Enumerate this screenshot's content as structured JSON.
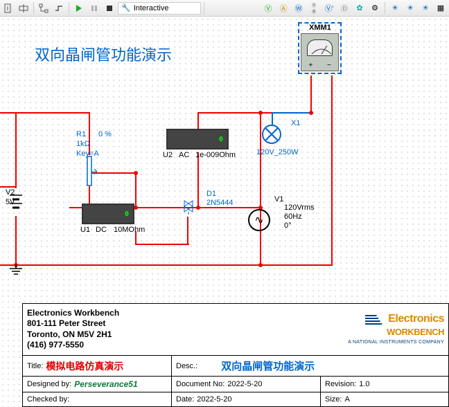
{
  "toolbar": {
    "mode_label": "Interactive"
  },
  "schematic": {
    "title": "双向晶闸管功能演示",
    "instruments": {
      "xmm1": {
        "ref": "XMM1"
      }
    },
    "components": {
      "r1": {
        "ref": "R1",
        "value": "1kΩ",
        "key": "Key=A",
        "percent": "0 %"
      },
      "v2": {
        "ref": "V2",
        "value": "5V"
      },
      "u1": {
        "ref": "U1",
        "mode": "DC",
        "imp": "10MOhm",
        "reading": "0"
      },
      "u2": {
        "ref": "U2",
        "mode": "AC",
        "imp": "1e-009Ohm",
        "reading": "0"
      },
      "d1": {
        "ref": "D1",
        "part": "2N5444"
      },
      "v1": {
        "ref": "V1",
        "amp": "120Vrms",
        "freq": "60Hz",
        "phase": "0°"
      },
      "x1": {
        "ref": "X1",
        "spec": "120V_250W"
      }
    }
  },
  "titleblock": {
    "company": "Electronics Workbench",
    "addr1": "801-111 Peter Street",
    "addr2": "Toronto, ON M5V 2H1",
    "phone": "(416) 977-5550",
    "logo_main": "Electronics",
    "logo_sub": "WORKBENCH",
    "logo_tag": "A NATIONAL INSTRUMENTS COMPANY",
    "title_lbl": "Title:",
    "title_val": "模拟电路仿真演示",
    "desc_lbl": "Desc.:",
    "desc_val": "双向晶闸管功能演示",
    "designed_lbl": "Designed by:",
    "designed_val": "Perseverance51",
    "docno_lbl": "Document No:",
    "docno_val": "2022-5-20",
    "rev_lbl": "Revision:",
    "rev_val": "1.0",
    "checked_lbl": "Checked by:",
    "checked_val": "",
    "date_lbl": "Date:",
    "date_val": "2022-5-20",
    "size_lbl": "Size:",
    "size_val": "A"
  }
}
